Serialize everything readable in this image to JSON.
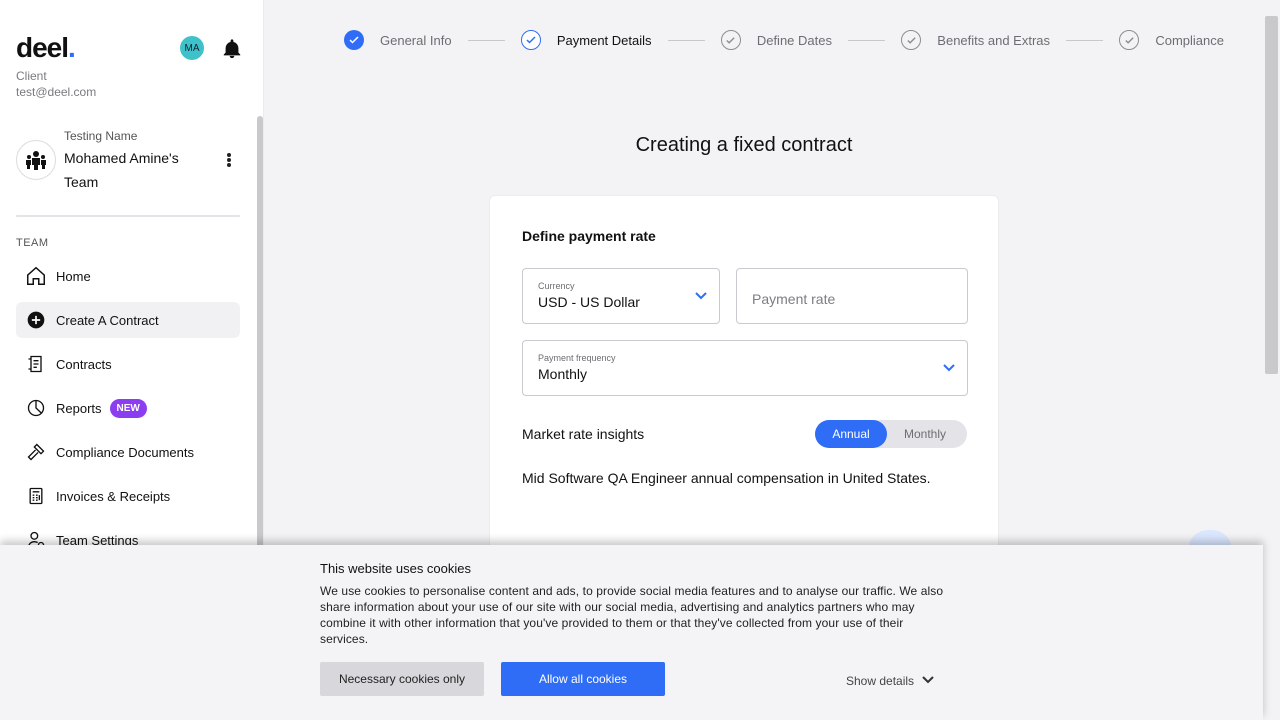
{
  "sidebar": {
    "logo_text": "deel",
    "logo_dot": ".",
    "avatar_initials": "MA",
    "role": "Client",
    "email": "test@deel.com",
    "team": {
      "subtitle": "Testing Name",
      "name": "Mohamed Amine's Team"
    },
    "section_label": "TEAM",
    "items": [
      {
        "label": "Home",
        "icon": "home-icon"
      },
      {
        "label": "Create A Contract",
        "icon": "plus-circle-icon",
        "active": true
      },
      {
        "label": "Contracts",
        "icon": "contract-icon"
      },
      {
        "label": "Reports",
        "icon": "pie-chart-icon",
        "badge": "NEW"
      },
      {
        "label": "Compliance Documents",
        "icon": "gavel-icon"
      },
      {
        "label": "Invoices & Receipts",
        "icon": "calculator-icon"
      },
      {
        "label": "Team Settings",
        "icon": "user-settings-icon"
      }
    ]
  },
  "stepper": {
    "steps": [
      {
        "label": "General Info",
        "state": "done"
      },
      {
        "label": "Payment Details",
        "state": "current"
      },
      {
        "label": "Define Dates",
        "state": "todo"
      },
      {
        "label": "Benefits and Extras",
        "state": "todo"
      },
      {
        "label": "Compliance",
        "state": "todo"
      }
    ]
  },
  "main": {
    "title": "Creating a fixed contract",
    "card": {
      "heading": "Define payment rate",
      "currency": {
        "label": "Currency",
        "value": "USD - US Dollar"
      },
      "payment_rate": {
        "placeholder": "Payment rate"
      },
      "frequency": {
        "label": "Payment frequency",
        "value": "Monthly"
      },
      "insights": {
        "label": "Market rate insights",
        "toggle": {
          "selected": "Annual",
          "options": [
            "Annual",
            "Monthly"
          ]
        },
        "text": "Mid Software QA Engineer annual compensation in United States."
      }
    }
  },
  "cookie_banner": {
    "title": "This website uses cookies",
    "text": "We use cookies to personalise content and ads, to provide social media features and to analyse our traffic. We also share information about your use of our site with our social media, advertising and analytics partners who may combine it with other information that you've provided to them or that they've collected from your use of their services.",
    "necessary_label": "Necessary cookies only",
    "allow_label": "Allow all cookies",
    "details_label": "Show details"
  },
  "colors": {
    "accent": "#2f6df6",
    "badge": "#8b3df0",
    "avatar": "#3fc1c9"
  }
}
